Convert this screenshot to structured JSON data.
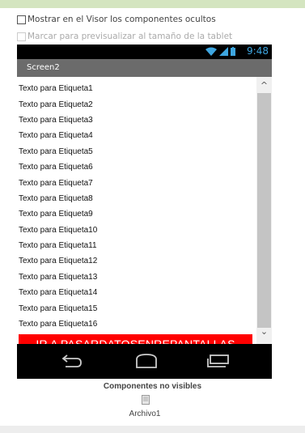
{
  "designer": {
    "show_hidden_label": "Mostrar en el Visor los componentes ocultos",
    "tablet_preview_label": "Marcar para previsualizar al tamaño de la tablet"
  },
  "phone": {
    "clock": "9:48",
    "screen_title": "Screen2",
    "labels": [
      "Texto para Etiqueta1",
      "Texto para Etiqueta2",
      "Texto para Etiqueta3",
      "Texto para Etiqueta4",
      "Texto para Etiqueta5",
      "Texto para Etiqueta6",
      "Texto para Etiqueta7",
      "Texto para Etiqueta8",
      "Texto para Etiqueta9",
      "Texto para Etiqueta10",
      "Texto para Etiqueta11",
      "Texto para Etiqueta12",
      "Texto para Etiqueta13",
      "Texto para Etiqueta14",
      "Texto para Etiqueta15",
      "Texto para Etiqueta16"
    ],
    "button_label": "IR A PASARDATOSENREPANTALLAS",
    "button_color": "#ff0000"
  },
  "nonvisible": {
    "title": "Componentes no visibles",
    "items": [
      "Archivo1"
    ]
  }
}
